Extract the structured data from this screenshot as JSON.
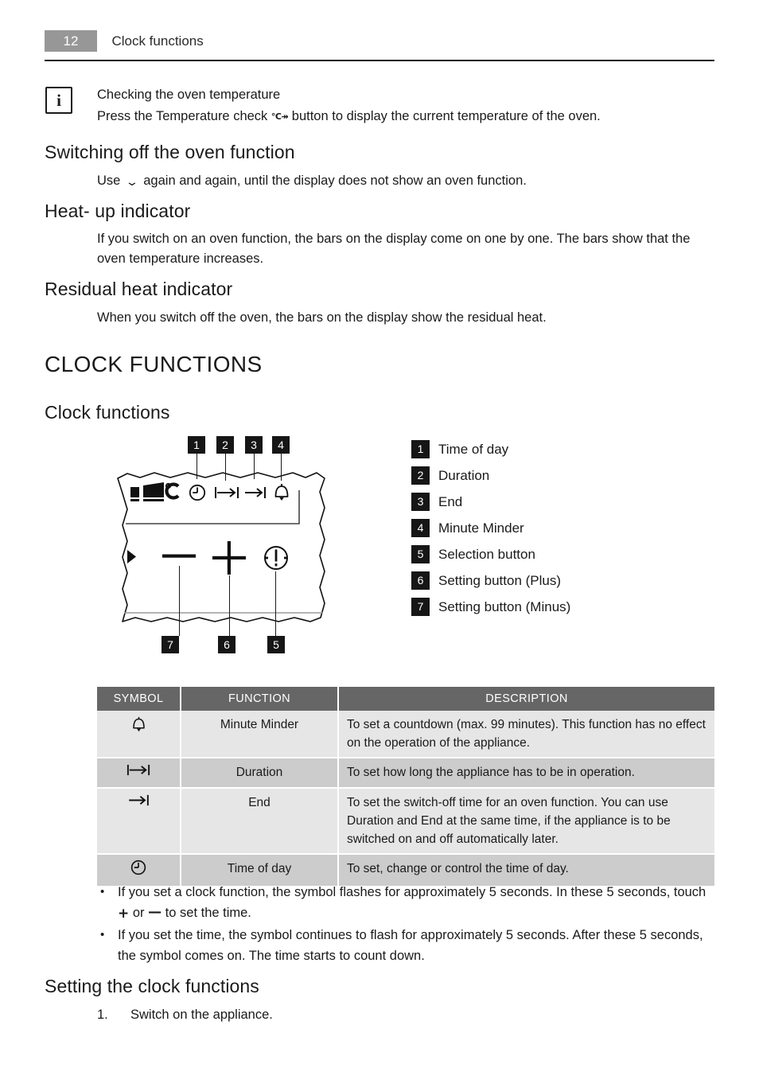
{
  "header": {
    "page_number": "12",
    "title": "Clock functions"
  },
  "note": {
    "icon": "info-icon",
    "icon_glyph": "i",
    "heading": "Checking the oven temperature",
    "text_before": "Press the Temperature check ",
    "symbol": "°C↠",
    "text_after": " button to display the current temperature of the oven."
  },
  "sections": [
    {
      "heading": "Switching off the oven function",
      "text_before": "Use ",
      "symbol": "⌄",
      "text_after": " again and again, until the display does not show an oven function."
    },
    {
      "heading": "Heat- up indicator",
      "text": "If you switch on an oven function, the bars on the display come on one by one. The bars show that the oven temperature increases."
    },
    {
      "heading": "Residual heat indicator",
      "text": "When you switch off the oven, the bars on the display show the residual heat."
    }
  ],
  "chapter_title": "CLOCK FUNCTIONS",
  "subsection_title": "Clock functions",
  "diagram": {
    "top_callouts": [
      "1",
      "2",
      "3",
      "4"
    ],
    "bottom_callouts": [
      "7",
      "6",
      "5"
    ],
    "display_icons": [
      {
        "name": "heat-bars-celsius-icon",
        "glyph": "°C"
      },
      {
        "name": "clock-icon",
        "glyph": "◴"
      },
      {
        "name": "duration-icon",
        "glyph": "|→|"
      },
      {
        "name": "end-icon",
        "glyph": "→|"
      },
      {
        "name": "bell-icon",
        "glyph": "⌂"
      }
    ],
    "button_icons": [
      {
        "name": "arrow-marker-icon",
        "glyph": "▶"
      },
      {
        "name": "minus-button-icon",
        "glyph": "—"
      },
      {
        "name": "plus-button-icon",
        "glyph": "+"
      },
      {
        "name": "selection-button-icon",
        "glyph": "ⓘ"
      }
    ]
  },
  "legend": [
    {
      "num": "1",
      "label": "Time of day"
    },
    {
      "num": "2",
      "label": "Duration"
    },
    {
      "num": "3",
      "label": "End"
    },
    {
      "num": "4",
      "label": "Minute Minder"
    },
    {
      "num": "5",
      "label": "Selection button"
    },
    {
      "num": "6",
      "label": "Setting button (Plus)"
    },
    {
      "num": "7",
      "label": "Setting button (Minus)"
    }
  ],
  "table": {
    "columns": [
      "SYMBOL",
      "FUNCTION",
      "DESCRIPTION"
    ],
    "rows": [
      {
        "symbol_name": "bell-icon",
        "function": "Minute Minder",
        "description": "To set a countdown (max. 99 minutes). This function has no effect on the operation of the appliance."
      },
      {
        "symbol_name": "duration-icon",
        "function": "Duration",
        "description": "To set how long the appliance has to be in operation."
      },
      {
        "symbol_name": "end-icon",
        "function": "End",
        "description": "To set the switch-off time for an oven function.\nYou can use Duration and End at the same time, if the appliance is to be switched on and off automatically later."
      },
      {
        "symbol_name": "clock-icon",
        "function": "Time of day",
        "description": "To set, change or control the time of day."
      }
    ]
  },
  "bullets": [
    {
      "part1": "If you set a clock function, the symbol flashes for approximately 5 seconds. In these 5 seconds, touch ",
      "sym1": "+",
      "part2": " or ",
      "sym2": "—",
      "part3": " to set the time."
    },
    {
      "text": "If you set the time, the symbol continues to flash for approximately 5 seconds. After these 5 seconds, the symbol comes on. The time starts to count down."
    }
  ],
  "setting_section": {
    "heading": "Setting the clock functions",
    "steps": [
      {
        "num": "1.",
        "text": "Switch on the appliance."
      }
    ]
  },
  "colors": {
    "page_badge": "#979797",
    "table_header": "#666666",
    "row_light": "#e6e6e6",
    "row_dark": "#cccccc",
    "callout": "#161616"
  }
}
